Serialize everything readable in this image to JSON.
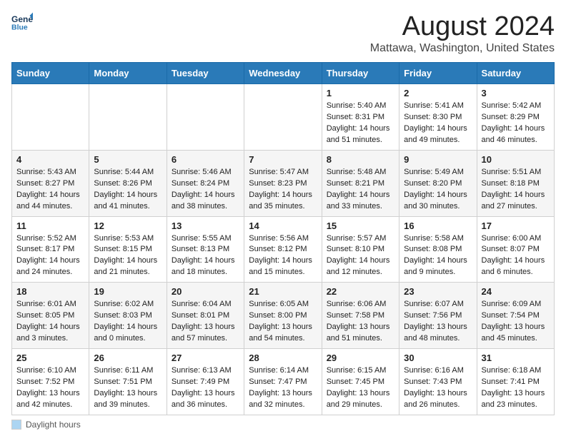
{
  "header": {
    "logo_line1": "General",
    "logo_line2": "Blue",
    "month_title": "August 2024",
    "location": "Mattawa, Washington, United States"
  },
  "weekdays": [
    "Sunday",
    "Monday",
    "Tuesday",
    "Wednesday",
    "Thursday",
    "Friday",
    "Saturday"
  ],
  "footer": {
    "legend_label": "Daylight hours"
  },
  "weeks": [
    [
      {
        "day": "",
        "sunrise": "",
        "sunset": "",
        "daylight": ""
      },
      {
        "day": "",
        "sunrise": "",
        "sunset": "",
        "daylight": ""
      },
      {
        "day": "",
        "sunrise": "",
        "sunset": "",
        "daylight": ""
      },
      {
        "day": "",
        "sunrise": "",
        "sunset": "",
        "daylight": ""
      },
      {
        "day": "1",
        "sunrise": "Sunrise: 5:40 AM",
        "sunset": "Sunset: 8:31 PM",
        "daylight": "Daylight: 14 hours and 51 minutes."
      },
      {
        "day": "2",
        "sunrise": "Sunrise: 5:41 AM",
        "sunset": "Sunset: 8:30 PM",
        "daylight": "Daylight: 14 hours and 49 minutes."
      },
      {
        "day": "3",
        "sunrise": "Sunrise: 5:42 AM",
        "sunset": "Sunset: 8:29 PM",
        "daylight": "Daylight: 14 hours and 46 minutes."
      }
    ],
    [
      {
        "day": "4",
        "sunrise": "Sunrise: 5:43 AM",
        "sunset": "Sunset: 8:27 PM",
        "daylight": "Daylight: 14 hours and 44 minutes."
      },
      {
        "day": "5",
        "sunrise": "Sunrise: 5:44 AM",
        "sunset": "Sunset: 8:26 PM",
        "daylight": "Daylight: 14 hours and 41 minutes."
      },
      {
        "day": "6",
        "sunrise": "Sunrise: 5:46 AM",
        "sunset": "Sunset: 8:24 PM",
        "daylight": "Daylight: 14 hours and 38 minutes."
      },
      {
        "day": "7",
        "sunrise": "Sunrise: 5:47 AM",
        "sunset": "Sunset: 8:23 PM",
        "daylight": "Daylight: 14 hours and 35 minutes."
      },
      {
        "day": "8",
        "sunrise": "Sunrise: 5:48 AM",
        "sunset": "Sunset: 8:21 PM",
        "daylight": "Daylight: 14 hours and 33 minutes."
      },
      {
        "day": "9",
        "sunrise": "Sunrise: 5:49 AM",
        "sunset": "Sunset: 8:20 PM",
        "daylight": "Daylight: 14 hours and 30 minutes."
      },
      {
        "day": "10",
        "sunrise": "Sunrise: 5:51 AM",
        "sunset": "Sunset: 8:18 PM",
        "daylight": "Daylight: 14 hours and 27 minutes."
      }
    ],
    [
      {
        "day": "11",
        "sunrise": "Sunrise: 5:52 AM",
        "sunset": "Sunset: 8:17 PM",
        "daylight": "Daylight: 14 hours and 24 minutes."
      },
      {
        "day": "12",
        "sunrise": "Sunrise: 5:53 AM",
        "sunset": "Sunset: 8:15 PM",
        "daylight": "Daylight: 14 hours and 21 minutes."
      },
      {
        "day": "13",
        "sunrise": "Sunrise: 5:55 AM",
        "sunset": "Sunset: 8:13 PM",
        "daylight": "Daylight: 14 hours and 18 minutes."
      },
      {
        "day": "14",
        "sunrise": "Sunrise: 5:56 AM",
        "sunset": "Sunset: 8:12 PM",
        "daylight": "Daylight: 14 hours and 15 minutes."
      },
      {
        "day": "15",
        "sunrise": "Sunrise: 5:57 AM",
        "sunset": "Sunset: 8:10 PM",
        "daylight": "Daylight: 14 hours and 12 minutes."
      },
      {
        "day": "16",
        "sunrise": "Sunrise: 5:58 AM",
        "sunset": "Sunset: 8:08 PM",
        "daylight": "Daylight: 14 hours and 9 minutes."
      },
      {
        "day": "17",
        "sunrise": "Sunrise: 6:00 AM",
        "sunset": "Sunset: 8:07 PM",
        "daylight": "Daylight: 14 hours and 6 minutes."
      }
    ],
    [
      {
        "day": "18",
        "sunrise": "Sunrise: 6:01 AM",
        "sunset": "Sunset: 8:05 PM",
        "daylight": "Daylight: 14 hours and 3 minutes."
      },
      {
        "day": "19",
        "sunrise": "Sunrise: 6:02 AM",
        "sunset": "Sunset: 8:03 PM",
        "daylight": "Daylight: 14 hours and 0 minutes."
      },
      {
        "day": "20",
        "sunrise": "Sunrise: 6:04 AM",
        "sunset": "Sunset: 8:01 PM",
        "daylight": "Daylight: 13 hours and 57 minutes."
      },
      {
        "day": "21",
        "sunrise": "Sunrise: 6:05 AM",
        "sunset": "Sunset: 8:00 PM",
        "daylight": "Daylight: 13 hours and 54 minutes."
      },
      {
        "day": "22",
        "sunrise": "Sunrise: 6:06 AM",
        "sunset": "Sunset: 7:58 PM",
        "daylight": "Daylight: 13 hours and 51 minutes."
      },
      {
        "day": "23",
        "sunrise": "Sunrise: 6:07 AM",
        "sunset": "Sunset: 7:56 PM",
        "daylight": "Daylight: 13 hours and 48 minutes."
      },
      {
        "day": "24",
        "sunrise": "Sunrise: 6:09 AM",
        "sunset": "Sunset: 7:54 PM",
        "daylight": "Daylight: 13 hours and 45 minutes."
      }
    ],
    [
      {
        "day": "25",
        "sunrise": "Sunrise: 6:10 AM",
        "sunset": "Sunset: 7:52 PM",
        "daylight": "Daylight: 13 hours and 42 minutes."
      },
      {
        "day": "26",
        "sunrise": "Sunrise: 6:11 AM",
        "sunset": "Sunset: 7:51 PM",
        "daylight": "Daylight: 13 hours and 39 minutes."
      },
      {
        "day": "27",
        "sunrise": "Sunrise: 6:13 AM",
        "sunset": "Sunset: 7:49 PM",
        "daylight": "Daylight: 13 hours and 36 minutes."
      },
      {
        "day": "28",
        "sunrise": "Sunrise: 6:14 AM",
        "sunset": "Sunset: 7:47 PM",
        "daylight": "Daylight: 13 hours and 32 minutes."
      },
      {
        "day": "29",
        "sunrise": "Sunrise: 6:15 AM",
        "sunset": "Sunset: 7:45 PM",
        "daylight": "Daylight: 13 hours and 29 minutes."
      },
      {
        "day": "30",
        "sunrise": "Sunrise: 6:16 AM",
        "sunset": "Sunset: 7:43 PM",
        "daylight": "Daylight: 13 hours and 26 minutes."
      },
      {
        "day": "31",
        "sunrise": "Sunrise: 6:18 AM",
        "sunset": "Sunset: 7:41 PM",
        "daylight": "Daylight: 13 hours and 23 minutes."
      }
    ]
  ]
}
